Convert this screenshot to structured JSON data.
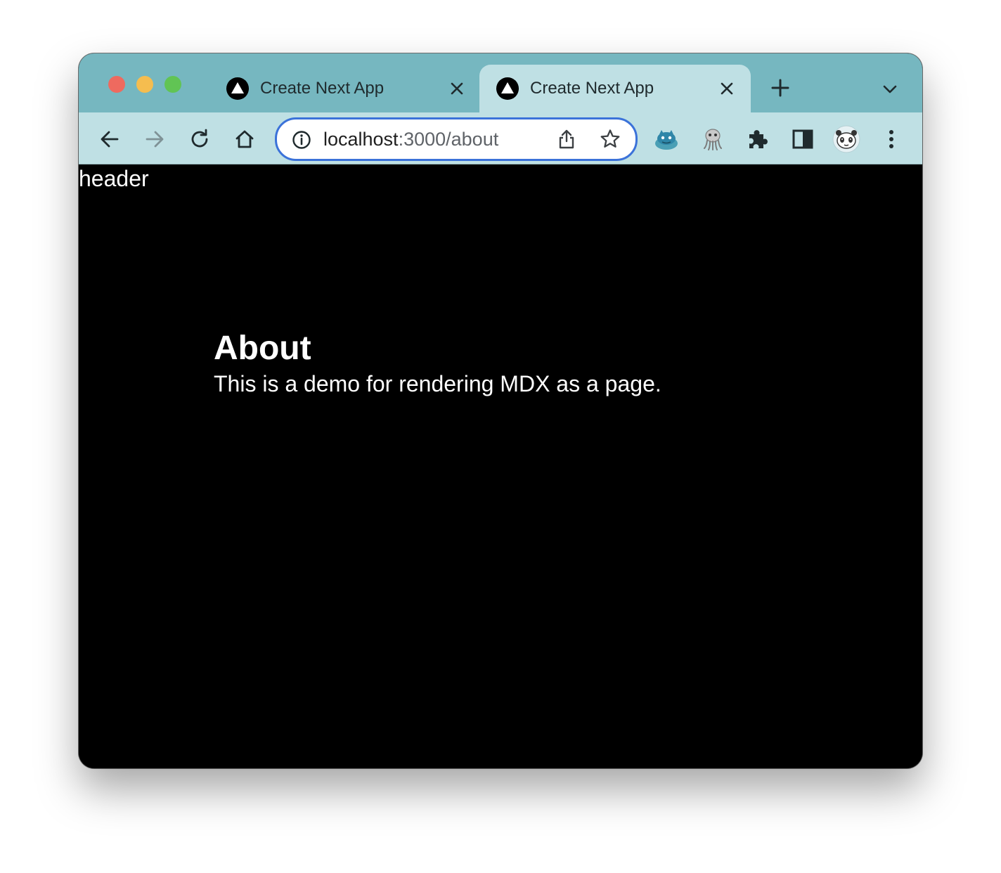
{
  "browser": {
    "tabs": [
      {
        "title": "Create Next App",
        "active": false,
        "favicon": "nextjs-triangle-icon"
      },
      {
        "title": "Create Next App",
        "active": true,
        "favicon": "nextjs-triangle-icon"
      }
    ],
    "address_bar": {
      "host": "localhost",
      "path": ":3000/about"
    },
    "toolbar_icons": [
      "back-icon",
      "forward-icon",
      "reload-icon",
      "home-icon",
      "info-icon",
      "share-icon",
      "bookmark-star-icon",
      "extensions-puzzle-icon",
      "side-panel-icon",
      "profile-avatar",
      "menu-kebab-icon"
    ],
    "colors": {
      "tabstrip": "#76b7c0",
      "toolbar": "#bfe0e4",
      "omnibox_border": "#3b72d9",
      "page_background": "#000000",
      "page_text": "#ffffff"
    }
  },
  "page": {
    "header_text": "header",
    "heading": "About",
    "paragraph": "This is a demo for rendering MDX as a page."
  }
}
